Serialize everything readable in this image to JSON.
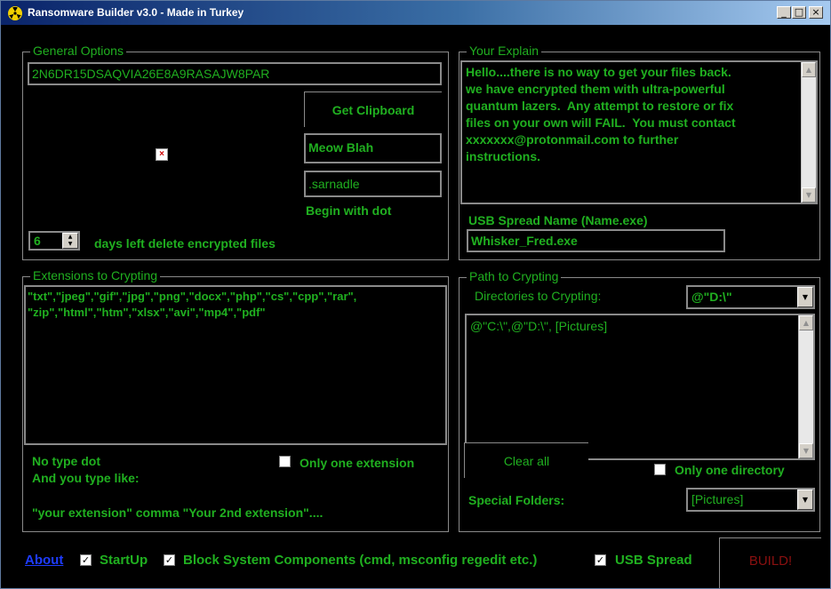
{
  "window": {
    "title": "Ransomware Builder v3.0 - Made in Turkey"
  },
  "general": {
    "legend": "General Options",
    "key_value": "2N6DR15DSAQVIA26E8A9RASAJW8PAR",
    "get_clipboard_label": "Get Clipboard",
    "name_value": "Meow Blah",
    "extension_value": ".sarnadle",
    "begin_with_dot": "Begin with dot",
    "days_value": "6",
    "days_label": "days left delete encrypted files"
  },
  "explain": {
    "legend": "Your Explain",
    "text": "Hello....there is no way to get your files back.\nwe have encrypted them with ultra-powerful\nquantum lazers.  Any attempt to restore or fix\nfiles on your own will FAIL.  You must contact\nxxxxxxx@protonmail.com to further\ninstructions.",
    "usb_label": "USB Spread Name (Name.exe)",
    "usb_value": "Whisker_Fred.exe"
  },
  "extensions": {
    "legend": "Extensions to Crypting",
    "text": "\"txt\",\"jpeg\",\"gif\",\"jpg\",\"png\",\"docx\",\"php\",\"cs\",\"cpp\",\"rar\",\n\"zip\",\"html\",\"htm\",\"xlsx\",\"avi\",\"mp4\",\"pdf\"",
    "no_type_dot": "No type dot",
    "and_you_type": "And you type like:",
    "only_one_extension": "Only one extension",
    "example": "\"your extension\" comma \"Your 2nd extension\"...."
  },
  "path": {
    "legend": "Path to Crypting",
    "directories_label": "Directories to Crypting:",
    "directory_selected": "@\"D:\\\"",
    "list_text": "@\"C:\\\",@\"D:\\\", [Pictures]",
    "clear_all": "Clear all",
    "only_one_directory": "Only one directory",
    "special_folders_label": "Special Folders:",
    "special_folder_selected": "[Pictures]"
  },
  "footer": {
    "about": "About",
    "startup": "StartUp",
    "block_components": "Block System Components (cmd, msconfig regedit etc.)",
    "usb_spread": "USB Spread",
    "build": "BUILD!"
  },
  "colors": {
    "text_green": "#20b020",
    "background": "#000000",
    "build_red": "#8b1010",
    "link_blue": "#1e3cff"
  },
  "icons": [
    "radiation-icon",
    "minimize-icon",
    "maximize-icon",
    "close-icon",
    "broken-image-icon",
    "checkbox-icon",
    "dropdown-arrow-icon",
    "scroll-arrow-icon",
    "spin-arrow-icon"
  ]
}
